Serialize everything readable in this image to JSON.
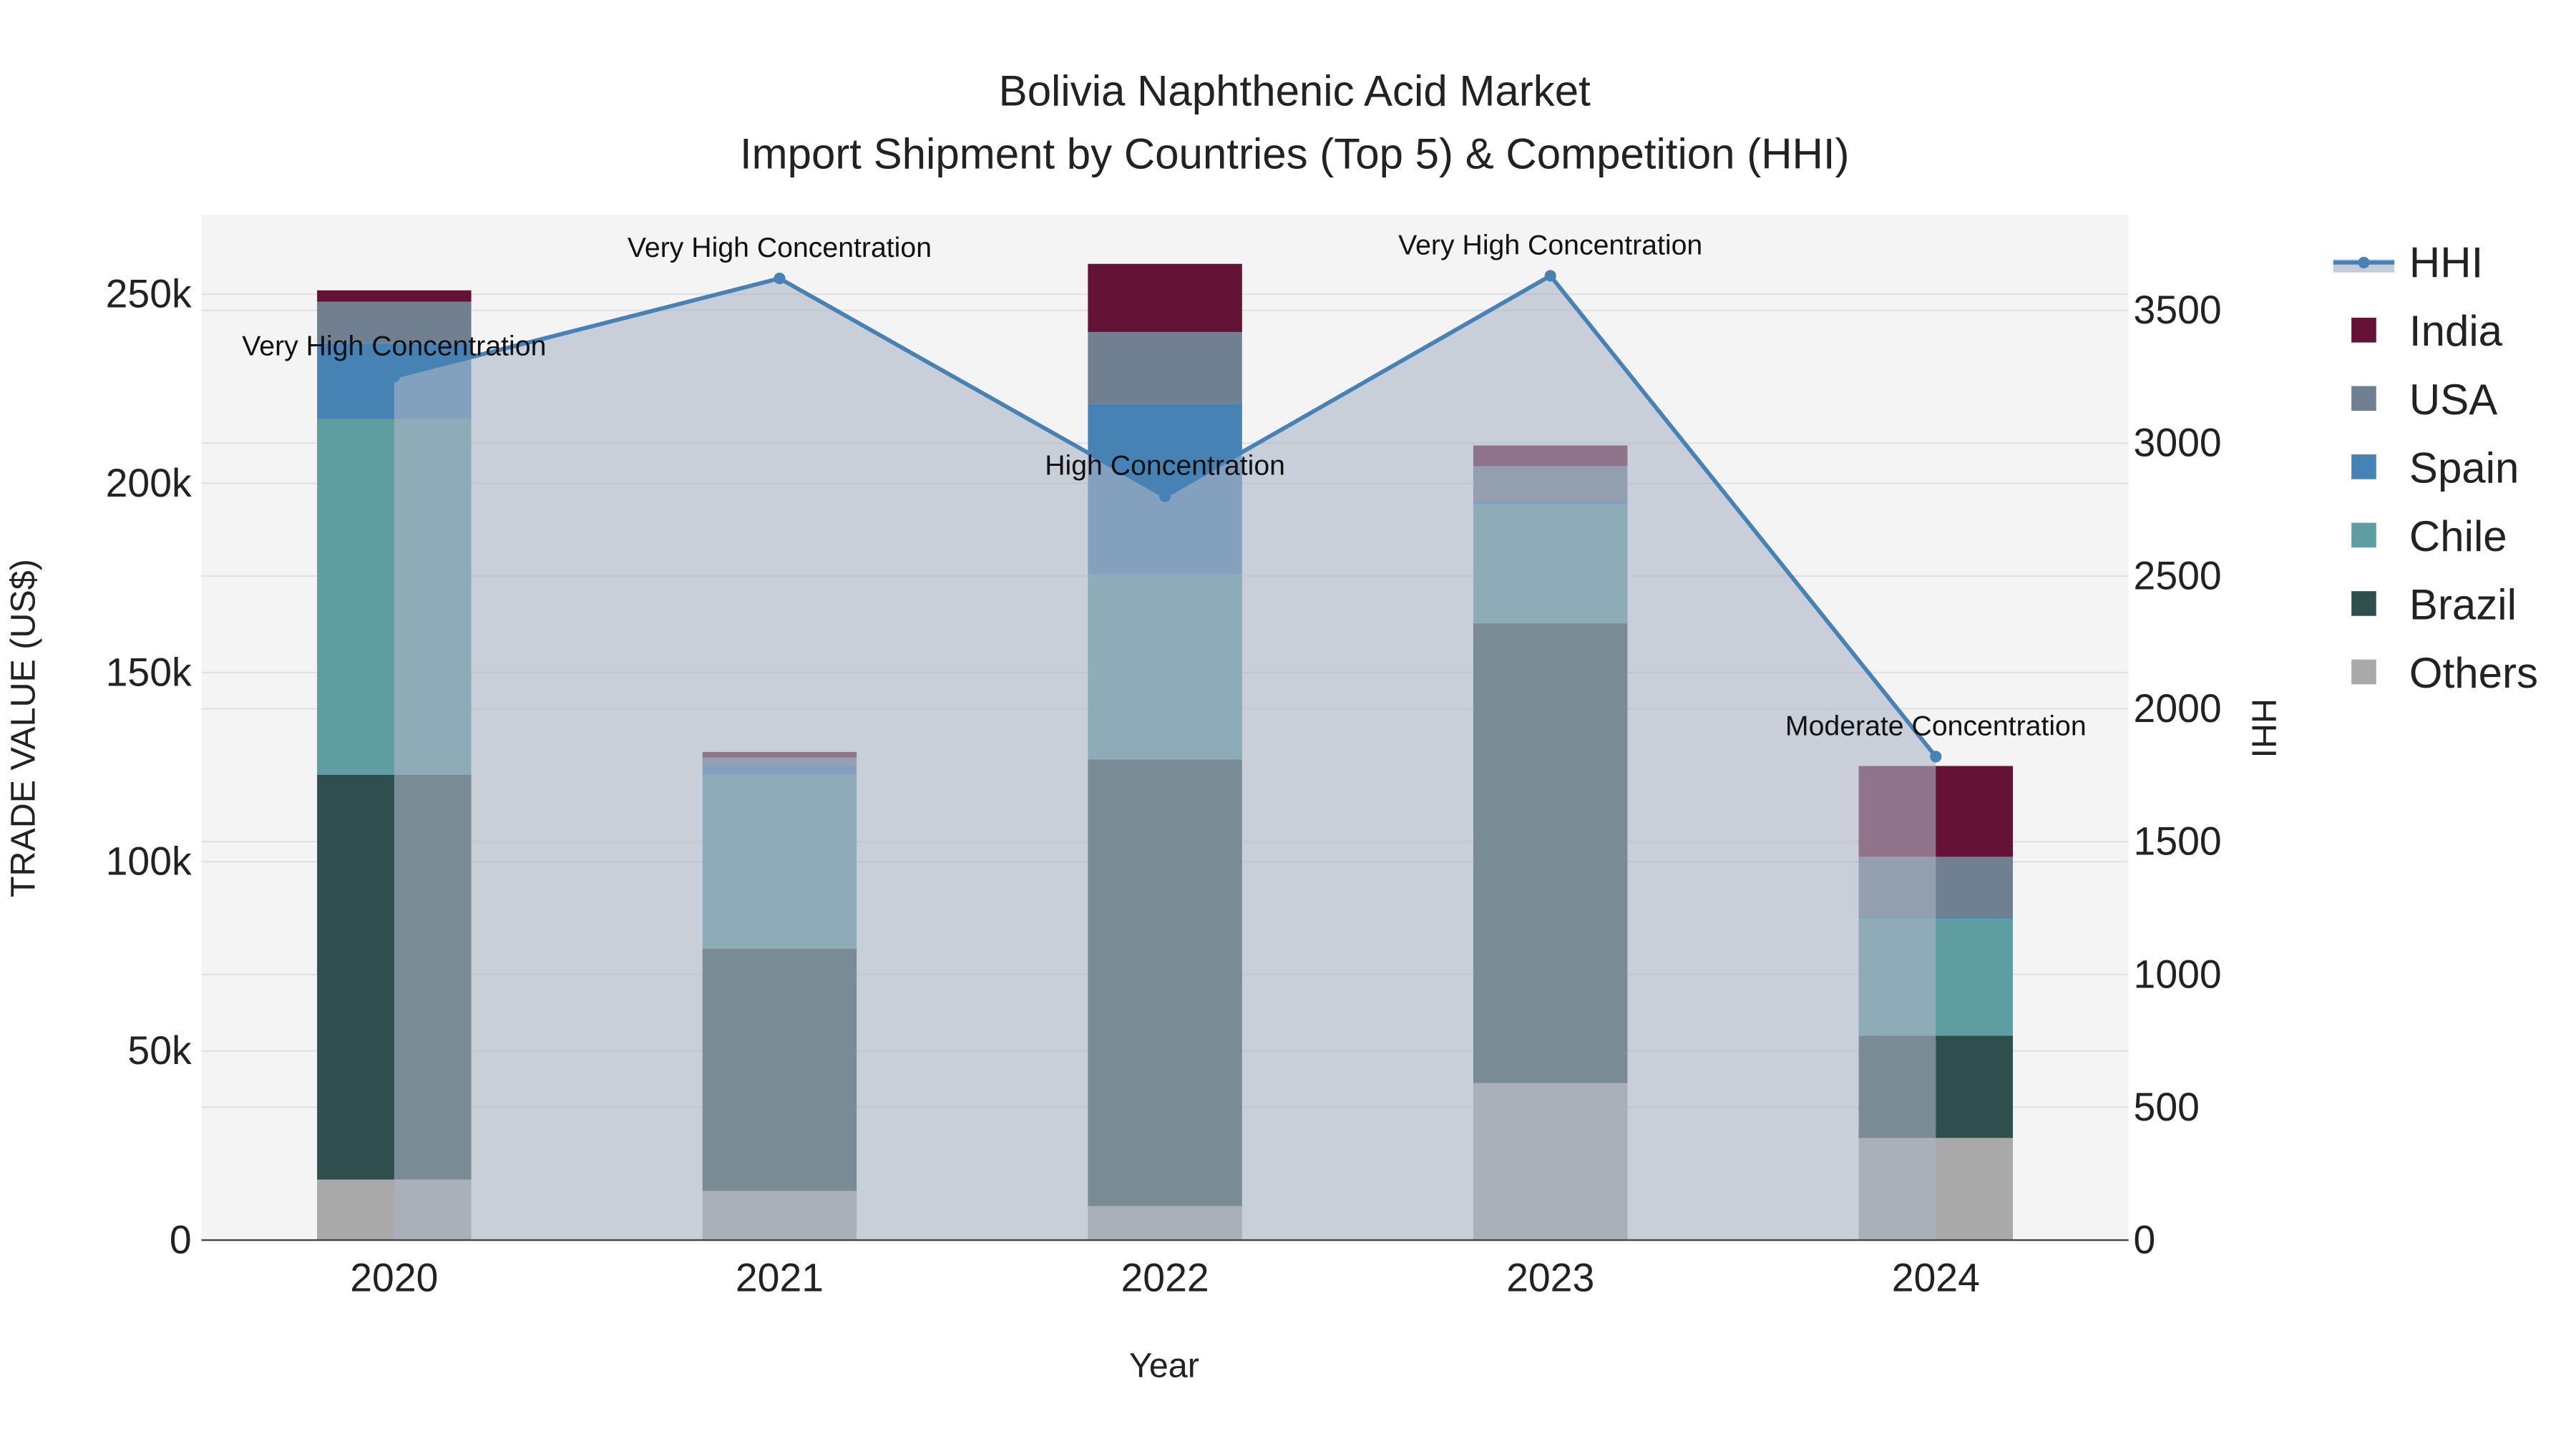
{
  "chart_data": {
    "type": "bar",
    "title": "Bolivia Naphthenic Acid Market",
    "subtitle": "Import Shipment by Countries (Top 5) & Competition (HHI)",
    "xlabel": "Year",
    "ylabel": "TRADE VALUE (US$)",
    "y2label": "HHI",
    "categories": [
      "2020",
      "2021",
      "2022",
      "2023",
      "2024"
    ],
    "ylim": [
      0,
      271000
    ],
    "y2lim": [
      0,
      3860
    ],
    "yticks": [
      0,
      50000,
      100000,
      150000,
      200000,
      250000
    ],
    "ytick_labels": [
      "0",
      "50k",
      "100k",
      "150k",
      "200k",
      "250k"
    ],
    "y2ticks": [
      0,
      500,
      1000,
      1500,
      2000,
      2500,
      3000,
      3500
    ],
    "y2tick_labels": [
      "0",
      "500",
      "1000",
      "1500",
      "2000",
      "2500",
      "3000",
      "3500"
    ],
    "stacked": true,
    "series": [
      {
        "name": "Others",
        "color": "#A9A9A9",
        "values": [
          16000,
          13000,
          9000,
          41500,
          27000
        ]
      },
      {
        "name": "Brazil",
        "color": "#2F4F4F",
        "values": [
          107000,
          64000,
          118000,
          121500,
          27000
        ]
      },
      {
        "name": "Chile",
        "color": "#5F9EA0",
        "values": [
          94000,
          46000,
          49000,
          31500,
          31000
        ]
      },
      {
        "name": "Spain",
        "color": "#4682B4",
        "values": [
          20000,
          2500,
          45000,
          1000,
          300
        ]
      },
      {
        "name": "USA",
        "color": "#708090",
        "values": [
          11000,
          2000,
          19000,
          9000,
          16000
        ]
      },
      {
        "name": "India",
        "color": "#641236",
        "values": [
          3000,
          1500,
          18000,
          5500,
          24000
        ]
      }
    ],
    "line": {
      "name": "HHI",
      "color": "#4682B4",
      "axis": "right",
      "values": [
        3250,
        3620,
        2800,
        3630,
        1820
      ],
      "annotations": [
        "Very High Concentration",
        "Very High Concentration",
        "High Concentration",
        "Very High Concentration",
        "Moderate Concentration"
      ]
    },
    "legend_order": [
      "HHI",
      "India",
      "USA",
      "Spain",
      "Chile",
      "Brazil",
      "Others"
    ],
    "legend_position": "right",
    "grid": true
  }
}
